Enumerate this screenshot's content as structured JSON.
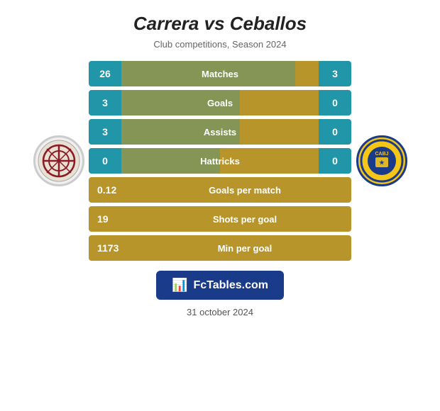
{
  "header": {
    "title": "Carrera vs Ceballos",
    "subtitle": "Club competitions, Season 2024"
  },
  "stats": {
    "rows": [
      {
        "id": "matches",
        "left_val": "26",
        "label": "Matches",
        "right_val": "3",
        "has_right": true,
        "bar_pct": 88
      },
      {
        "id": "goals",
        "left_val": "3",
        "label": "Goals",
        "right_val": "0",
        "has_right": true,
        "bar_pct": 60
      },
      {
        "id": "assists",
        "left_val": "3",
        "label": "Assists",
        "right_val": "0",
        "has_right": true,
        "bar_pct": 60
      },
      {
        "id": "hattricks",
        "left_val": "0",
        "label": "Hattricks",
        "right_val": "0",
        "has_right": true,
        "bar_pct": 50
      }
    ],
    "single_rows": [
      {
        "id": "goals-per-match",
        "left_val": "0.12",
        "label": "Goals per match"
      },
      {
        "id": "shots-per-goal",
        "left_val": "19",
        "label": "Shots per goal"
      },
      {
        "id": "min-per-goal",
        "left_val": "1173",
        "label": "Min per goal"
      }
    ]
  },
  "fctables": {
    "icon": "📊",
    "text": "FcTables.com"
  },
  "footer": {
    "date": "31 october 2024"
  }
}
